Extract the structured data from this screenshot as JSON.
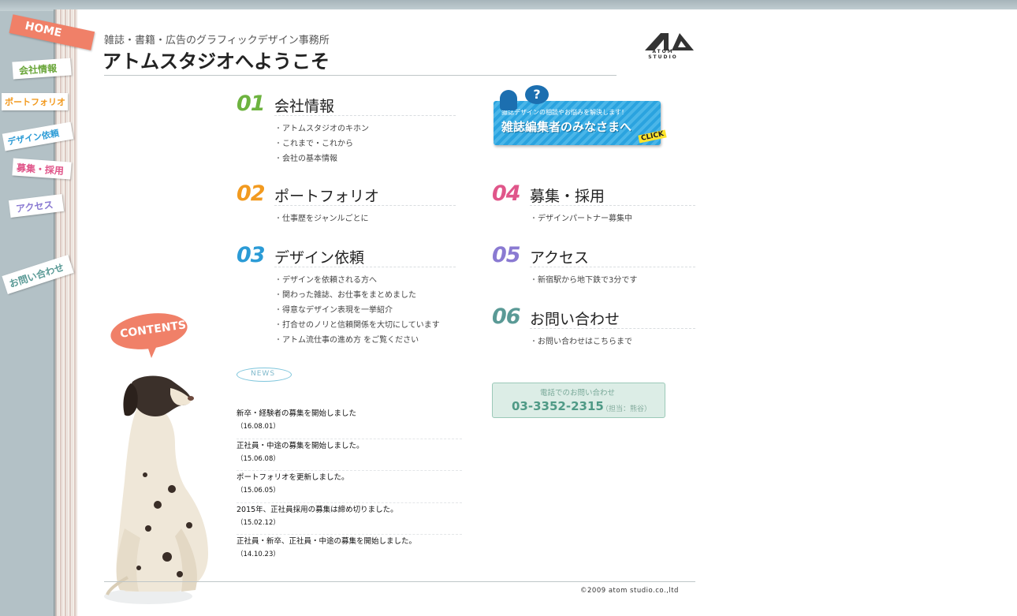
{
  "nav": {
    "home": "HOME",
    "company": "会社情報",
    "portfolio": "ポートフォリオ",
    "design": "デザイン依頼",
    "recruit": "募集・採用",
    "access": "アクセス",
    "contact": "お問い合わせ"
  },
  "header": {
    "subtitle": "雑誌・書籍・広告のグラフィックデザイン事務所",
    "title": "アトムスタジオへようこそ",
    "logo_text": "ATOM STUDIO"
  },
  "sections": [
    {
      "num": "01",
      "title": "会社情報",
      "color": "#6db33f",
      "links": [
        "アトムスタジオのキホン",
        "これまで・これから",
        "会社の基本情報"
      ]
    },
    {
      "num": "02",
      "title": "ポートフォリオ",
      "color": "#f29a1f",
      "links": [
        "仕事歴をジャンルごとに"
      ]
    },
    {
      "num": "03",
      "title": "デザイン依頼",
      "color": "#2b9bd6",
      "links": [
        "デザインを依頼される方へ",
        "関わった雑誌、お仕事をまとめました",
        "得意なデザイン表現を一挙紹介",
        "打合せのノリと信頼関係を大切にしています",
        "アトム流仕事の進め方 をご覧ください"
      ]
    },
    {
      "num": "04",
      "title": "募集・採用",
      "color": "#e0568a",
      "links": [
        "デザインパートナー募集中"
      ]
    },
    {
      "num": "05",
      "title": "アクセス",
      "color": "#8a7ad2",
      "links": [
        "新宿駅から地下鉄で3分です"
      ]
    },
    {
      "num": "06",
      "title": "お問い合わせ",
      "color": "#5a9a96",
      "links": [
        "お問い合わせはこちらまで"
      ]
    }
  ],
  "banner": {
    "small": "雑誌デザインの相談やお悩みを解決します！",
    "main": "雑誌編集者のみなさまへ",
    "click": "CLICK",
    "bubble": "?"
  },
  "contents_label": "CONTENTS",
  "news": {
    "label": "NEWS",
    "items": [
      {
        "title": "新卒・経験者の募集を開始しました",
        "date": "（16.08.01）"
      },
      {
        "title": "正社員・中途の募集を開始しました。",
        "date": "（15.06.08）"
      },
      {
        "title": "ポートフォリオを更新しました。",
        "date": "（15.06.05）"
      },
      {
        "title": "2015年、正社員採用の募集は締め切りました。",
        "date": "（15.02.12）"
      },
      {
        "title": "正社員・新卒、正社員・中途の募集を開始しました。",
        "date": "（14.10.23）"
      }
    ]
  },
  "phone": {
    "label": "電話でのお問い合わせ",
    "number": "03-3352-2315",
    "person": "（担当：熊谷）"
  },
  "footer": {
    "copyright": "©2009 atom studio.co.,ltd"
  }
}
